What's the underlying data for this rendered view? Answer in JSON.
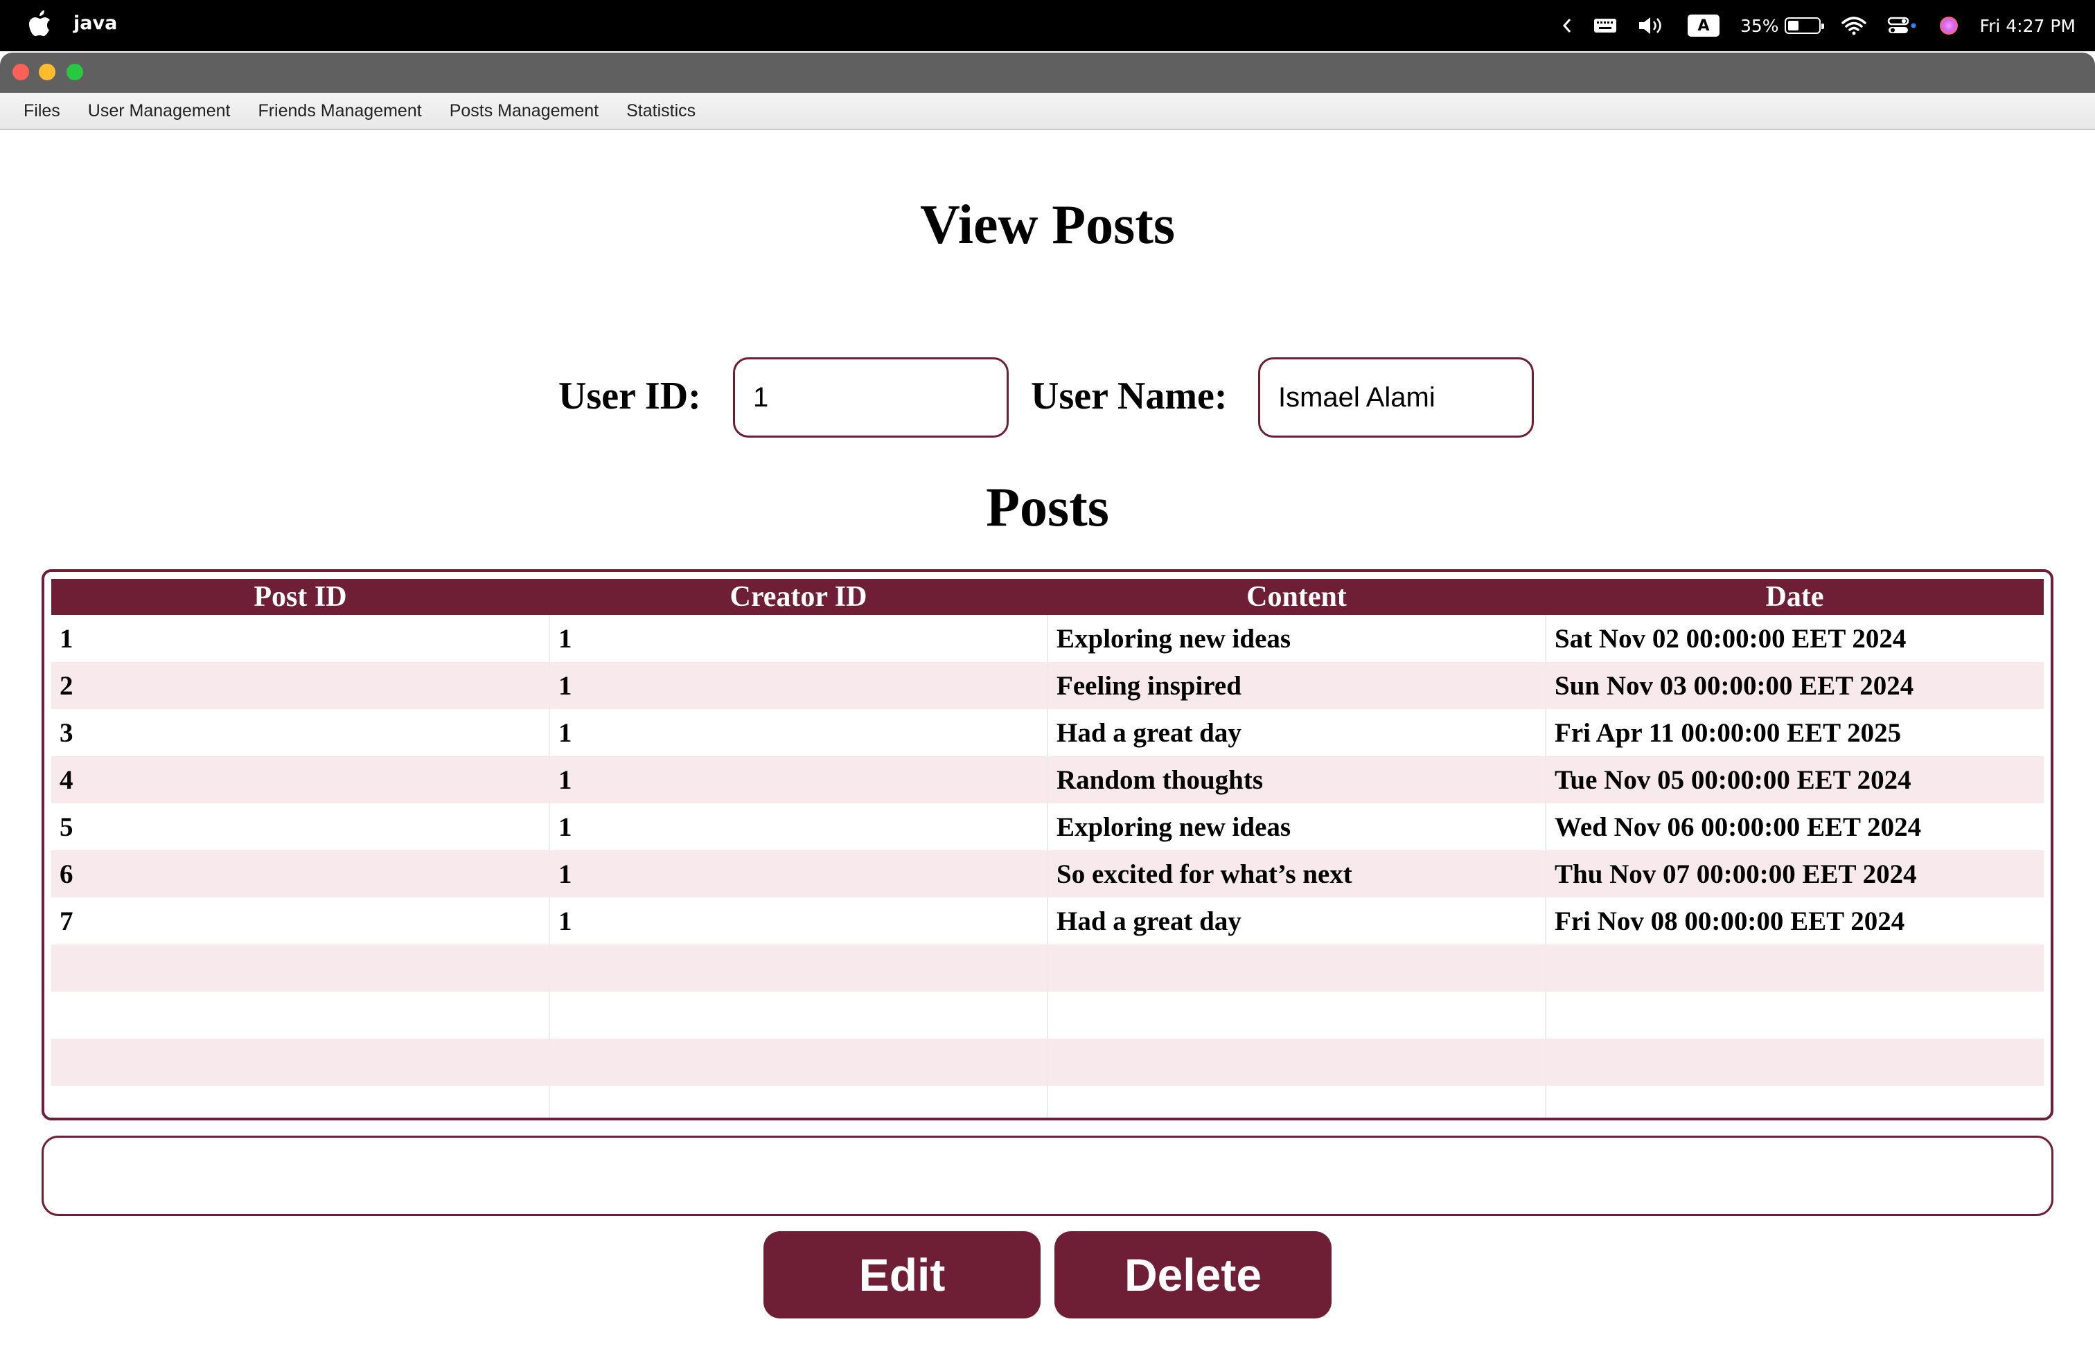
{
  "system_bar": {
    "app_name": "java",
    "battery_percent": "35%",
    "battery_level": 0.35,
    "keyboard_indicator": "A",
    "clock": "Fri 4:27 PM"
  },
  "app_menu": {
    "items": [
      "Files",
      "User Management",
      "Friends Management",
      "Posts Management",
      "Statistics"
    ]
  },
  "page": {
    "title": "View Posts",
    "user_id_label": "User ID:",
    "user_id_value": "1",
    "user_name_label": "User Name:",
    "user_name_value": "Ismael Alami",
    "posts_heading": "Posts"
  },
  "table": {
    "columns": [
      "Post ID",
      "Creator ID",
      "Content",
      "Date"
    ],
    "rows": [
      [
        "1",
        "1",
        "Exploring new ideas",
        "Sat Nov 02 00:00:00 EET 2024"
      ],
      [
        "2",
        "1",
        "Feeling inspired",
        "Sun Nov 03 00:00:00 EET 2024"
      ],
      [
        "3",
        "1",
        "Had a great day",
        "Fri Apr 11 00:00:00 EET 2025"
      ],
      [
        "4",
        "1",
        "Random thoughts",
        "Tue Nov 05 00:00:00 EET 2024"
      ],
      [
        "5",
        "1",
        "Exploring new ideas",
        "Wed Nov 06 00:00:00 EET 2024"
      ],
      [
        "6",
        "1",
        "So excited for what’s next",
        "Thu Nov 07 00:00:00 EET 2024"
      ],
      [
        "7",
        "1",
        "Had a great day",
        "Fri Nov 08 00:00:00 EET 2024"
      ],
      [
        "",
        "",
        "",
        ""
      ],
      [
        "",
        "",
        "",
        ""
      ],
      [
        "",
        "",
        "",
        ""
      ],
      [
        "",
        "",
        "",
        ""
      ]
    ]
  },
  "actions": {
    "edit_label": "Edit",
    "delete_label": "Delete"
  },
  "colors": {
    "accent": "#6e1f35",
    "row_alt": "#f7e9ec"
  }
}
